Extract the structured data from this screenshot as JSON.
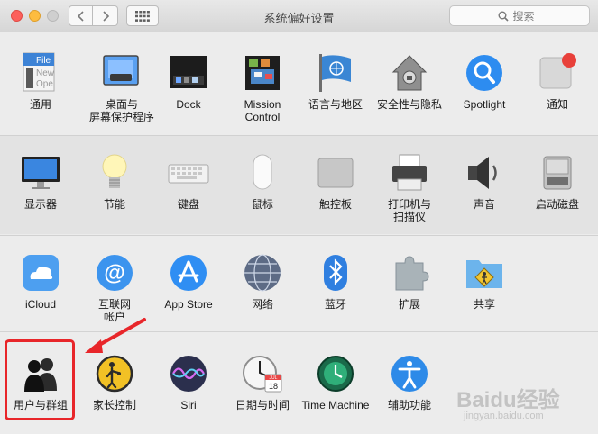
{
  "window": {
    "title": "系统偏好设置"
  },
  "search": {
    "placeholder": "搜索"
  },
  "rows": [
    [
      "通用",
      "桌面与\n屏幕保护程序",
      "Dock",
      "Mission\nControl",
      "语言与地区",
      "安全性与隐私",
      "Spotlight",
      "通知"
    ],
    [
      "显示器",
      "节能",
      "键盘",
      "鼠标",
      "触控板",
      "打印机与\n扫描仪",
      "声音",
      "启动磁盘"
    ],
    [
      "iCloud",
      "互联网\n帐户",
      "App Store",
      "网络",
      "蓝牙",
      "扩展",
      "共享"
    ],
    [
      "用户与群组",
      "家长控制",
      "Siri",
      "日期与时间",
      "Time Machine",
      "辅助功能"
    ]
  ],
  "icon_text": {
    "general_file": "File",
    "general_new": "New",
    "general_open": "Ope",
    "calendar_month": "JUL",
    "calendar_day": "18"
  },
  "watermark": {
    "brand": "Bai",
    "brand2": "du",
    "brand3": "经验",
    "url": "jingyan.baidu.com"
  },
  "colors": {
    "highlight": "#e8262a",
    "accent": "#3b8ee8"
  }
}
